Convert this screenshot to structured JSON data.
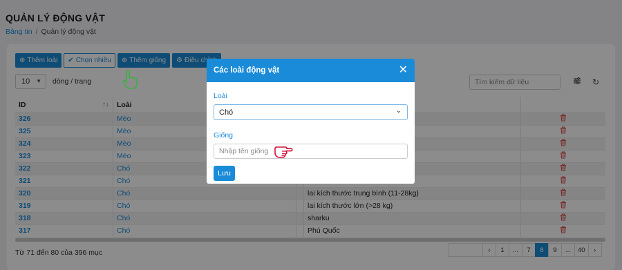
{
  "page": {
    "title": "QUẢN LÝ ĐỘNG VẬT",
    "breadcrumb": [
      "Bảng tin",
      "Quản lý động vật"
    ]
  },
  "toolbar": {
    "add_type": "Thêm loài",
    "select_many": "Chọn nhiều",
    "add_breed": "Thêm giống",
    "adjust": "Điều chỉnh"
  },
  "length": {
    "value": "10",
    "label": "dòng / trang"
  },
  "search": {
    "placeholder": "Tìm kiếm dữ liệu"
  },
  "table": {
    "columns": [
      "ID",
      "Loài",
      "",
      "",
      ""
    ],
    "rows": [
      {
        "id": "326",
        "type": "Mèo",
        "breed": ""
      },
      {
        "id": "325",
        "type": "Mèo",
        "breed": ""
      },
      {
        "id": "324",
        "type": "Mèo",
        "breed": ""
      },
      {
        "id": "323",
        "type": "Mèo",
        "breed": ""
      },
      {
        "id": "322",
        "type": "Chó",
        "breed": ""
      },
      {
        "id": "321",
        "type": "Chó",
        "breed": ""
      },
      {
        "id": "320",
        "type": "Chó",
        "breed": "lai kích thước trung bình (11-28kg)"
      },
      {
        "id": "319",
        "type": "Chó",
        "breed": "lai kích thước lớn (>28 kg)"
      },
      {
        "id": "318",
        "type": "Chó",
        "breed": "sharku"
      },
      {
        "id": "317",
        "type": "Chó",
        "breed": "Phú Quốc"
      }
    ]
  },
  "footer": {
    "info": "Từ 71 đến 80 của 396 mục"
  },
  "pagination": {
    "pages": [
      "1",
      "...",
      "7",
      "8",
      "9",
      "...",
      "40"
    ],
    "active": "8"
  },
  "modal": {
    "title": "Các loài động vật",
    "type_label": "Loài",
    "type_value": "Chó",
    "breed_label": "Giống",
    "breed_placeholder": "Nhập tên giống",
    "save": "Lưu"
  },
  "colors": {
    "accent": "#1a8bd8",
    "delete": "#d9534f",
    "hand_green": "#3cb043",
    "hand_red": "#d0103a"
  },
  "icons": [
    "plus-circle-icon",
    "check-icon",
    "gear-icon",
    "sort-icon",
    "filter-icon",
    "refresh-icon",
    "trash-icon",
    "close-icon",
    "chevron-down-icon",
    "pointing-hand-icon"
  ]
}
